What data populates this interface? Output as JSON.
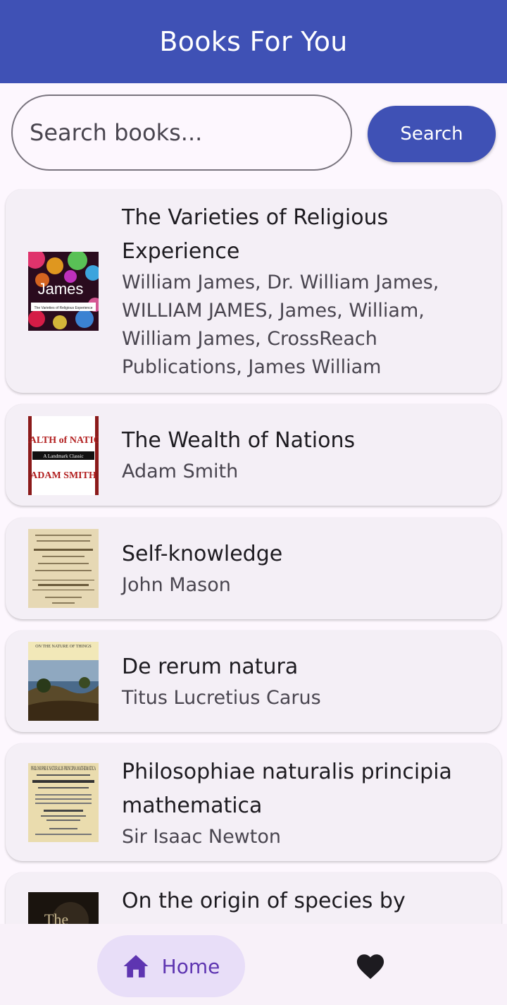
{
  "appbar": {
    "title": "Books For You"
  },
  "search": {
    "placeholder": "Search books...",
    "value": "",
    "button_label": "Search"
  },
  "books": [
    {
      "title": "The Varieties of Religious Experience",
      "author": "William James, Dr. William James, WILLIAM JAMES, James, William, William James, CrossReach Publications, James William",
      "cover_text": "James",
      "cover_subtitle": "The Varieties of Religious Experience"
    },
    {
      "title": "The Wealth of Nations",
      "author": "Adam Smith",
      "cover_text": "WEALTH of NATIONS",
      "cover_band": "A Landmark Classic",
      "cover_author": "ADAM SMITH"
    },
    {
      "title": "Self-knowledge",
      "author": "John Mason"
    },
    {
      "title": "De rerum natura",
      "author": "Titus Lucretius Carus",
      "cover_text": "ON THE NATURE OF THINGS"
    },
    {
      "title": "Philosophiae naturalis principia mathematica",
      "author": "Sir Isaac Newton",
      "cover_text": "PHILOSOPHIÆ NATURALIS PRINCIPIA MATHEMATICA"
    },
    {
      "title": "On the origin of species by",
      "author": ""
    }
  ],
  "nav": {
    "home_label": "Home",
    "home_icon": "home-icon",
    "favorites_icon": "heart-icon"
  },
  "colors": {
    "primary": "#3f51b5",
    "nav_active": "#e8def8",
    "nav_active_text": "#5e35b1",
    "card_bg": "#f4eff6"
  }
}
